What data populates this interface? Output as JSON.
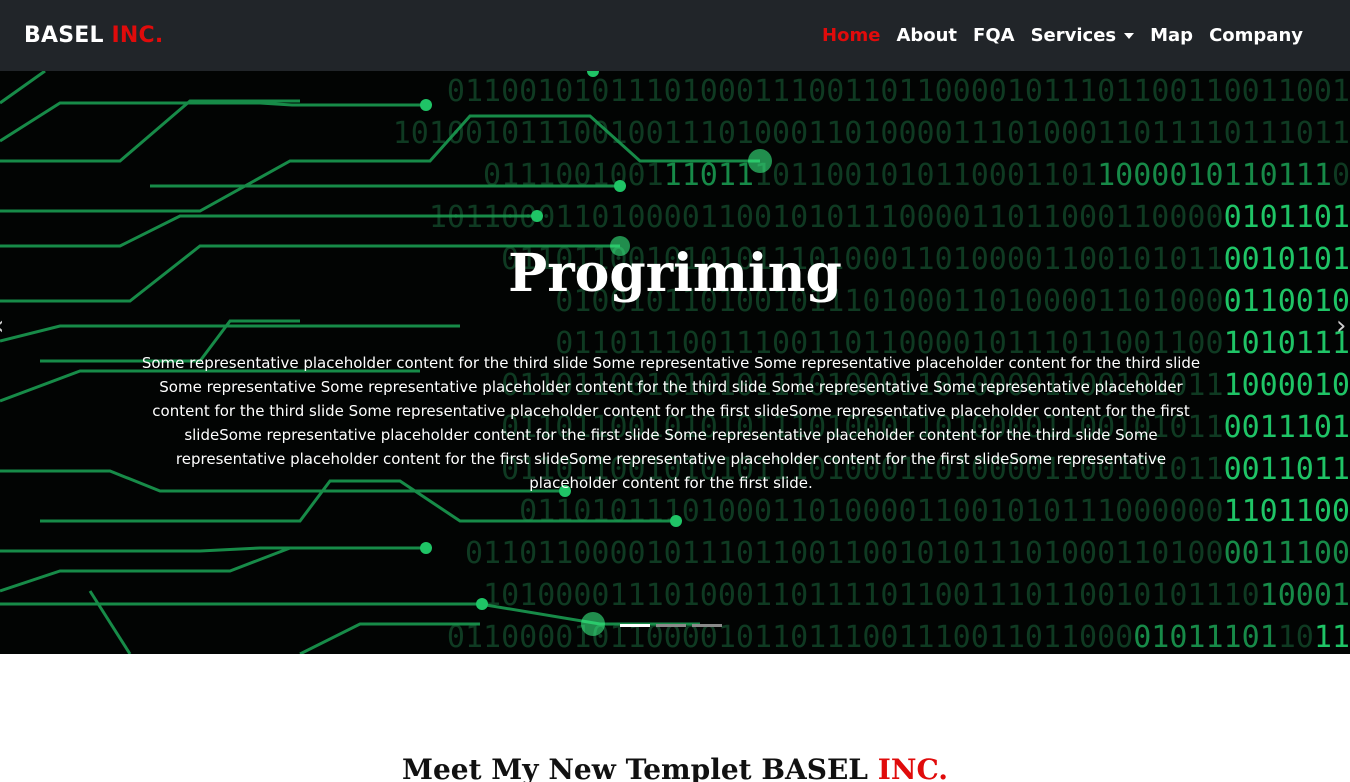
{
  "brand": {
    "name": "BASEL",
    "accent": "INC."
  },
  "nav": {
    "home": "Home",
    "about": "About",
    "fqa": "FQA",
    "services": "Services",
    "map": "Map",
    "company": "Company"
  },
  "hero": {
    "title": "Progriming",
    "text": "Some representative placeholder content for the third slide Some representative Some representative placeholder content for the third slide Some representative Some representative placeholder content for the third slide Some representative Some representative placeholder content for the third slide Some representative placeholder content for the first slideSome representative placeholder content for the first slideSome representative placeholder content for the first slide Some representative placeholder content for the third slide Some representative placeholder content for the first slideSome representative placeholder content for the first slideSome representative placeholder content for the first slide.",
    "slides": 3,
    "active_slide": 1
  },
  "section": {
    "title": "Meet My New Templet BASEL",
    "accent": "INC."
  },
  "colors": {
    "accent": "#e00b0b",
    "navbar": "#212529",
    "circuit": "#1fc466"
  },
  "icons": {
    "prev": "chevron-left-icon",
    "next": "chevron-right-icon",
    "dropdown": "caret-down-icon"
  }
}
